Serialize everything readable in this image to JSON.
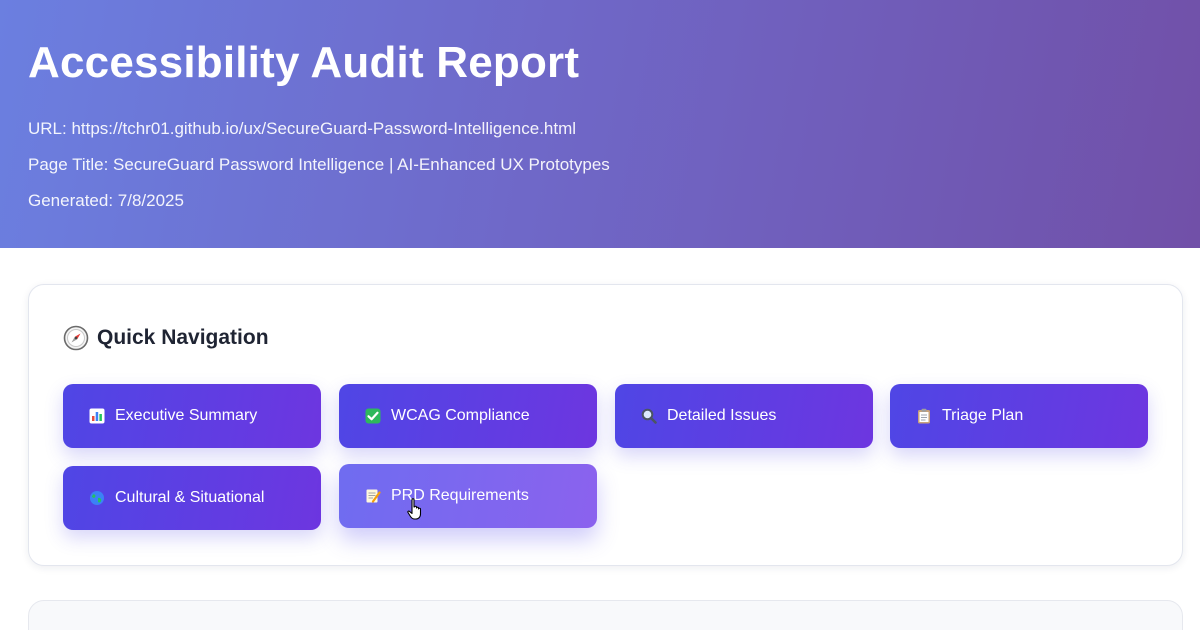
{
  "header": {
    "title": "Accessibility Audit Report",
    "url_line": "URL: https://tchr01.github.io/ux/SecureGuard-Password-Intelligence.html",
    "page_title_line": "Page Title: SecureGuard Password Intelligence | AI-Enhanced UX Prototypes",
    "generated_line": "Generated: 7/8/2025"
  },
  "quick_nav": {
    "heading": "Quick Navigation",
    "heading_icon": "compass-icon",
    "items": [
      {
        "label": "Executive Summary",
        "icon": "bar-chart-icon"
      },
      {
        "label": "WCAG Compliance",
        "icon": "check-mark-icon"
      },
      {
        "label": "Detailed Issues",
        "icon": "magnifier-icon"
      },
      {
        "label": "Triage Plan",
        "icon": "clipboard-icon"
      },
      {
        "label": "Cultural & Situational",
        "icon": "globe-icon"
      },
      {
        "label": "PRD Requirements",
        "icon": "memo-icon"
      }
    ],
    "hovered_item": "PRD Requirements"
  },
  "colors": {
    "header_gradient_start": "#6b7fe0",
    "header_gradient_end": "#7150a8",
    "button_gradient_start": "#4f46e5",
    "button_gradient_end": "#6d36e0"
  }
}
